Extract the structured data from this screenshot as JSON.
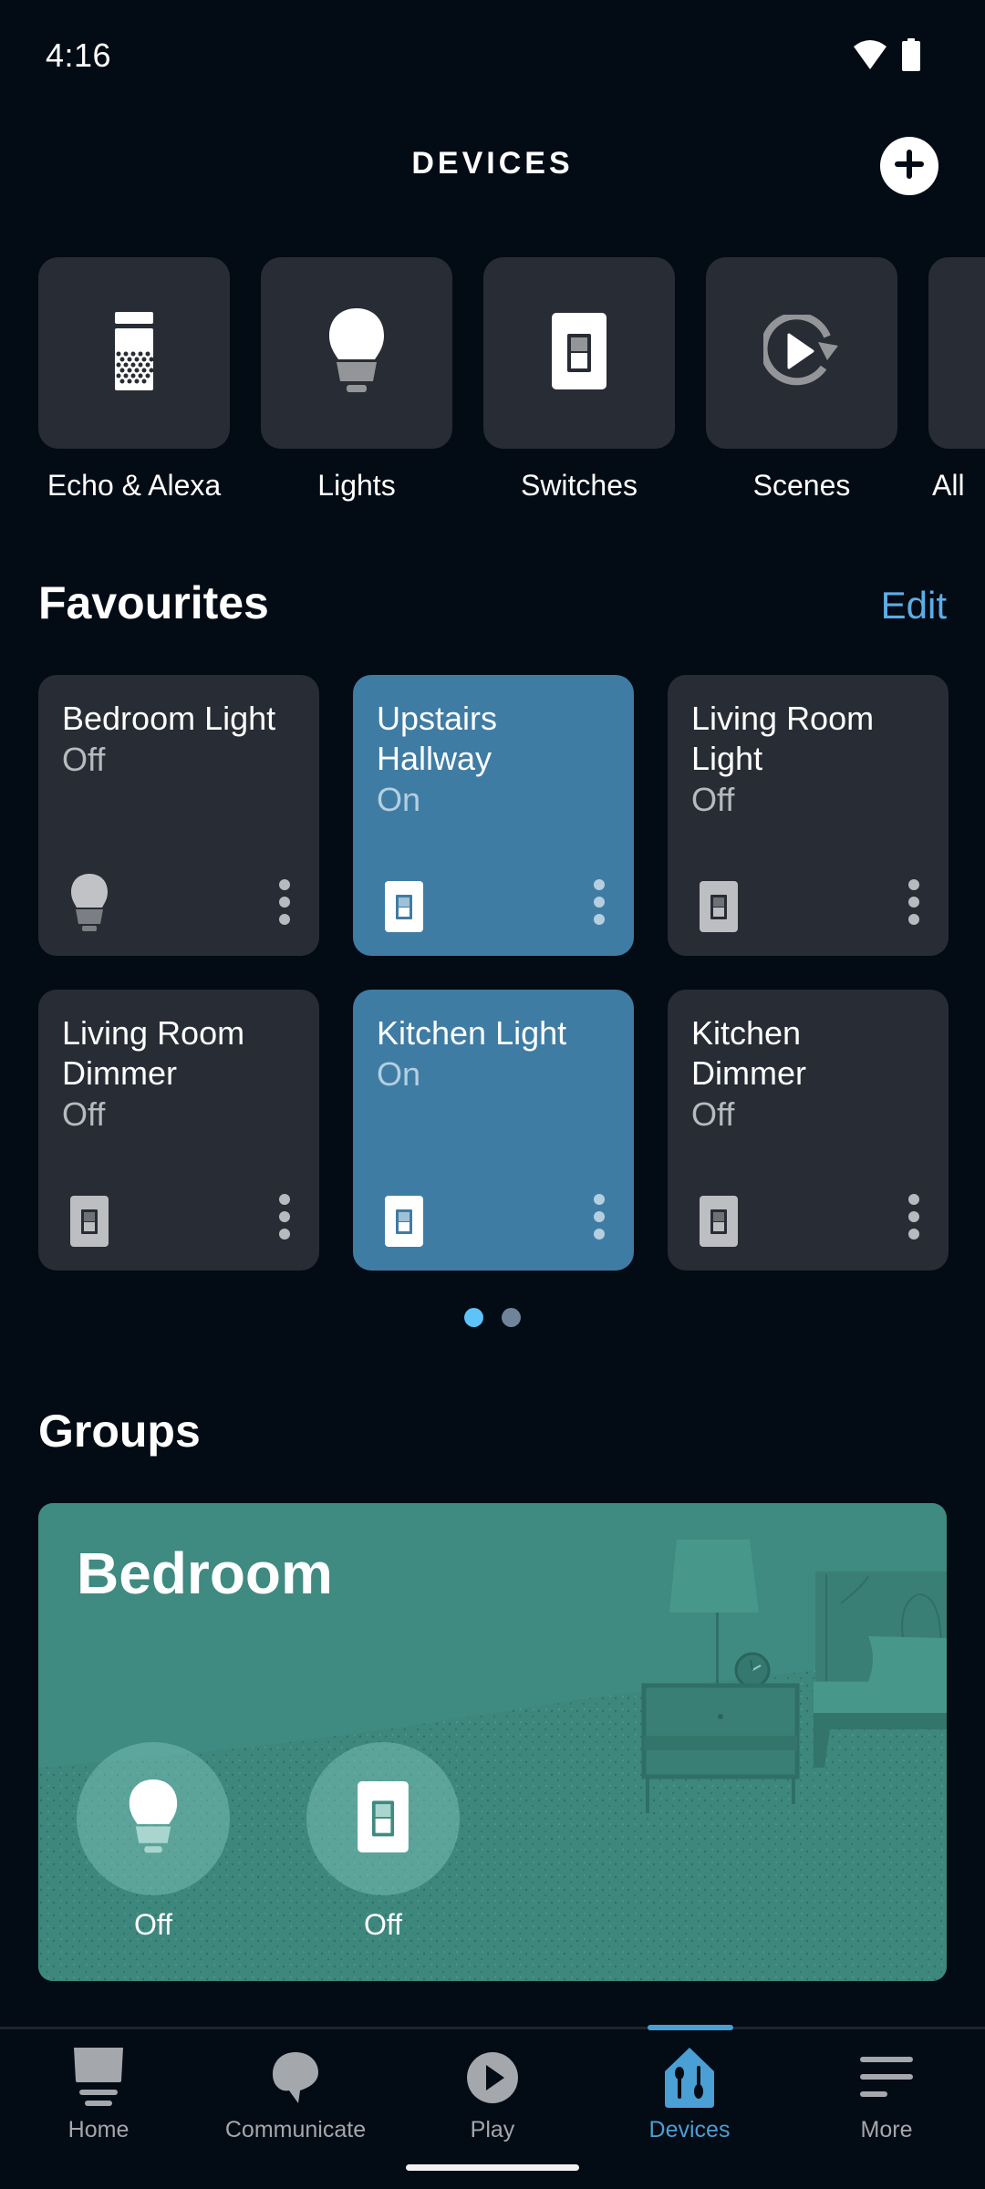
{
  "status_bar": {
    "time": "4:16",
    "icons": [
      "wifi-icon",
      "battery-icon"
    ]
  },
  "header": {
    "title": "DEVICES",
    "add_icon": "plus-circle-icon"
  },
  "categories": [
    {
      "label": "Echo & Alexa",
      "icon": "echo-speaker-icon"
    },
    {
      "label": "Lights",
      "icon": "light-bulb-icon"
    },
    {
      "label": "Switches",
      "icon": "light-switch-icon"
    },
    {
      "label": "Scenes",
      "icon": "scene-play-icon"
    },
    {
      "label": "All",
      "icon": ""
    }
  ],
  "favourites": {
    "title": "Favourites",
    "edit_label": "Edit",
    "items": [
      {
        "name": "Bedroom Light",
        "state": "Off",
        "on": false,
        "icon": "light-bulb-icon"
      },
      {
        "name": "Upstairs Hallway",
        "state": "On",
        "on": true,
        "icon": "light-switch-icon"
      },
      {
        "name": "Living Room Light",
        "state": "Off",
        "on": false,
        "icon": "light-switch-icon"
      },
      {
        "name": "Living Room Dimmer",
        "state": "Off",
        "on": false,
        "icon": "light-switch-icon"
      },
      {
        "name": "Kitchen Light",
        "state": "On",
        "on": true,
        "icon": "light-switch-icon"
      },
      {
        "name": "Kitchen Dimmer",
        "state": "Off",
        "on": false,
        "icon": "light-switch-icon"
      }
    ],
    "pager": {
      "pages": 2,
      "current": 1
    }
  },
  "groups": {
    "title": "Groups",
    "items": [
      {
        "name": "Bedroom",
        "devices": [
          {
            "icon": "light-bulb-icon",
            "state": "Off"
          },
          {
            "icon": "light-switch-icon",
            "state": "Off"
          }
        ]
      }
    ]
  },
  "bottom_nav": {
    "items": [
      {
        "label": "Home",
        "icon": "home-icon",
        "active": false
      },
      {
        "label": "Communicate",
        "icon": "chat-bubble-icon",
        "active": false
      },
      {
        "label": "Play",
        "icon": "play-icon",
        "active": false
      },
      {
        "label": "Devices",
        "icon": "devices-house-icon",
        "active": true
      },
      {
        "label": "More",
        "icon": "menu-icon",
        "active": false
      }
    ]
  },
  "colors": {
    "background": "#030b14",
    "card": "#282c34",
    "card_on": "#3f7ca4",
    "accent": "#5caee8",
    "group_card": "#3f8a81",
    "nav_active": "#4a9fd4"
  }
}
